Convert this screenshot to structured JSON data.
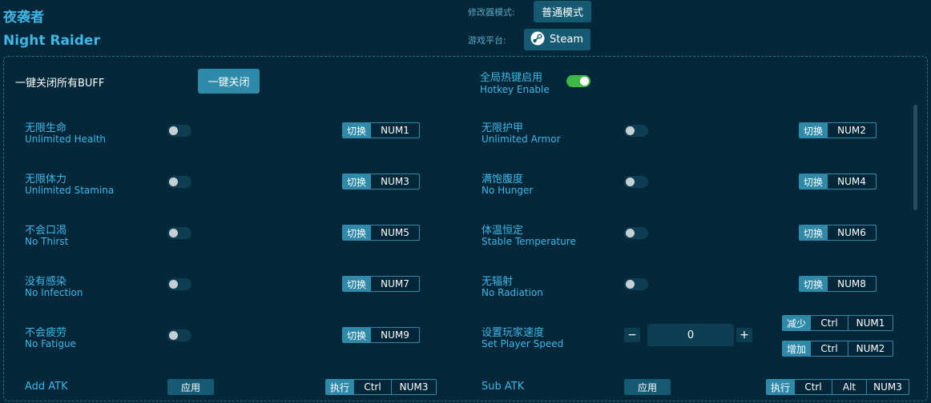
{
  "header": {
    "title_cn": "夜袭者",
    "title_en": "Night Raider",
    "mode_label": "修改器模式:",
    "mode_value": "普通模式",
    "platform_label": "游戏平台:",
    "platform_value": "Steam"
  },
  "top": {
    "close_all_label": "一键关闭所有BUFF",
    "close_all_button": "一键关闭",
    "global_hotkey_cn": "全局热键启用",
    "global_hotkey_en": "Hotkey Enable",
    "global_hotkey_on": true
  },
  "features": [
    {
      "cn": "无限生命",
      "en": "Unlimited Health",
      "tag": "切换",
      "key": "NUM1"
    },
    {
      "cn": "无限护甲",
      "en": "Unlimited Armor",
      "tag": "切换",
      "key": "NUM2"
    },
    {
      "cn": "无限体力",
      "en": "Unlimited Stamina",
      "tag": "切换",
      "key": "NUM3"
    },
    {
      "cn": "满饱腹度",
      "en": "No Hunger",
      "tag": "切换",
      "key": "NUM4"
    },
    {
      "cn": "不会口渴",
      "en": "No Thirst",
      "tag": "切换",
      "key": "NUM5"
    },
    {
      "cn": "体温恒定",
      "en": "Stable Temperature",
      "tag": "切换",
      "key": "NUM6"
    },
    {
      "cn": "没有感染",
      "en": "No Infection",
      "tag": "切换",
      "key": "NUM7"
    },
    {
      "cn": "无辐射",
      "en": "No Radiation",
      "tag": "切换",
      "key": "NUM8"
    },
    {
      "cn": "不会疲劳",
      "en": "No Fatigue",
      "tag": "切换",
      "key": "NUM9"
    }
  ],
  "speed": {
    "cn": "设置玩家速度",
    "en": "Set Player Speed",
    "minus": "−",
    "value": "0",
    "plus": "+",
    "decrease": {
      "tag": "减少",
      "mod": "Ctrl",
      "key": "NUM1"
    },
    "increase": {
      "tag": "增加",
      "mod": "Ctrl",
      "key": "NUM2"
    }
  },
  "add_atk": {
    "label": "Add ATK",
    "apply": "应用",
    "tag": "执行",
    "mod": "Ctrl",
    "key": "NUM3"
  },
  "sub_atk": {
    "label": "Sub ATK",
    "apply": "应用",
    "tag": "执行",
    "mod": "Ctrl",
    "mod2": "Alt",
    "key": "NUM3"
  },
  "colors": {
    "background": "#04283a",
    "accent": "#3fb6e6",
    "button": "#2f89a8",
    "toggle_on": "#3fb847"
  }
}
